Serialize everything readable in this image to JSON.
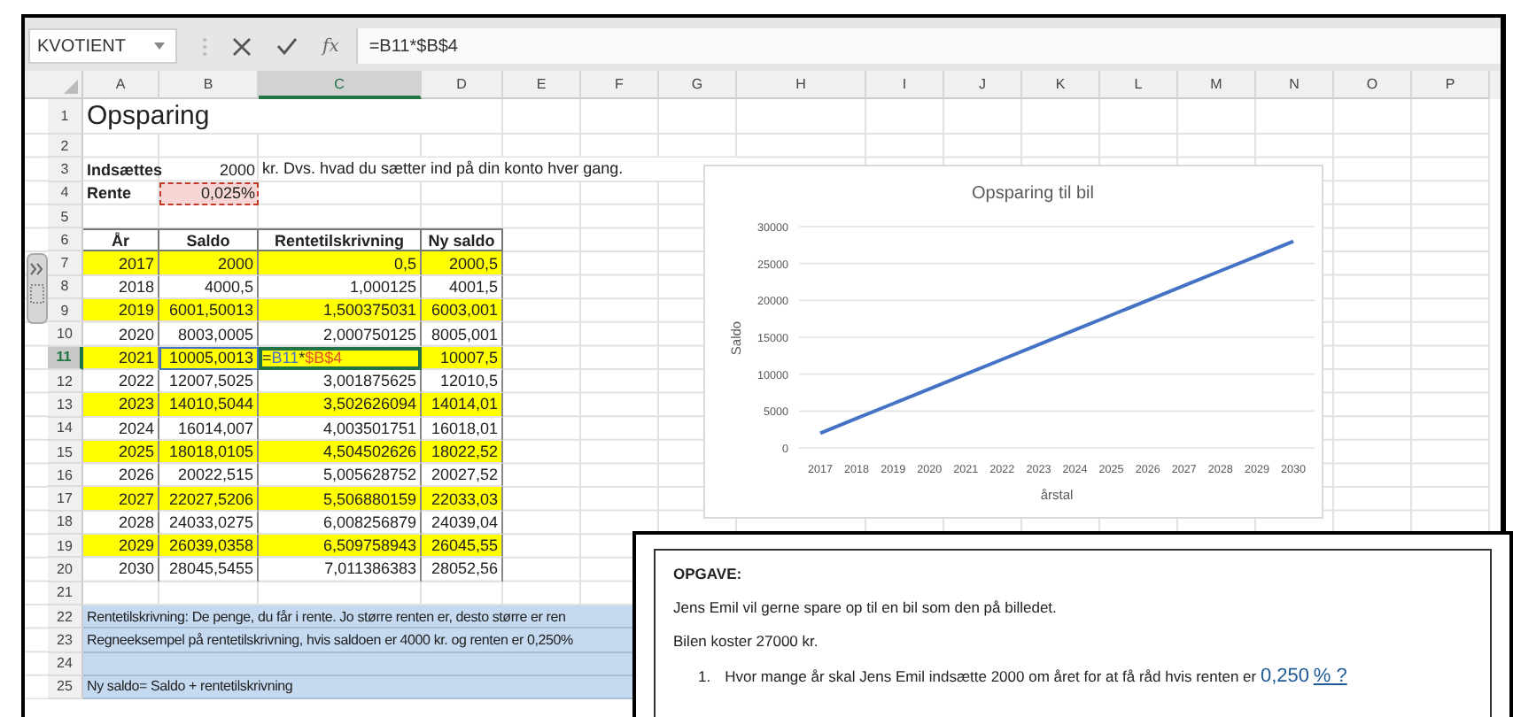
{
  "formula_bar": {
    "name_box": "KVOTIENT",
    "fx": "fx",
    "formula": "=B11*$B$4"
  },
  "columns": [
    {
      "label": "A",
      "selected": false
    },
    {
      "label": "B",
      "selected": false
    },
    {
      "label": "C",
      "selected": true
    },
    {
      "label": "D",
      "selected": false
    },
    {
      "label": "E",
      "selected": false
    },
    {
      "label": "F",
      "selected": false
    },
    {
      "label": "G",
      "selected": false
    },
    {
      "label": "H",
      "selected": false
    },
    {
      "label": "I",
      "selected": false
    },
    {
      "label": "J",
      "selected": false
    },
    {
      "label": "K",
      "selected": false
    },
    {
      "label": "L",
      "selected": false
    },
    {
      "label": "M",
      "selected": false
    },
    {
      "label": "N",
      "selected": false
    },
    {
      "label": "O",
      "selected": false
    },
    {
      "label": "P",
      "selected": false
    }
  ],
  "rows": [
    {
      "number": "1",
      "kind": "title",
      "text": "Opsparing"
    },
    {
      "number": "2",
      "kind": "blank"
    },
    {
      "number": "3",
      "kind": "input",
      "label": "Indsættes",
      "value": "2000",
      "note": "kr. Dvs. hvad du sætter ind på din konto hver gang.",
      "referenced": false
    },
    {
      "number": "4",
      "kind": "input",
      "label": "Rente",
      "value": "0,025%",
      "referenced": true
    },
    {
      "number": "5",
      "kind": "blank"
    },
    {
      "number": "6",
      "kind": "table_header",
      "cells": [
        "År",
        "Saldo",
        "Rentetilskrivning",
        "Ny saldo"
      ]
    },
    {
      "number": "7",
      "kind": "data",
      "highlighted": true,
      "selected": false,
      "year": "2017",
      "saldo": "2000",
      "rente": "0,5",
      "ny_saldo": "2000,5"
    },
    {
      "number": "8",
      "kind": "data",
      "highlighted": false,
      "selected": false,
      "year": "2018",
      "saldo": "4000,5",
      "rente": "1,000125",
      "ny_saldo": "4001,5"
    },
    {
      "number": "9",
      "kind": "data",
      "highlighted": true,
      "selected": false,
      "year": "2019",
      "saldo": "6001,50013",
      "rente": "1,500375031",
      "ny_saldo": "6003,001"
    },
    {
      "number": "10",
      "kind": "data",
      "highlighted": false,
      "selected": false,
      "year": "2020",
      "saldo": "8003,0005",
      "rente": "2,000750125",
      "ny_saldo": "8005,001"
    },
    {
      "number": "11",
      "kind": "data",
      "highlighted": true,
      "selected": true,
      "saldo_referenced": true,
      "year": "2021",
      "saldo": "10005,0013",
      "formula_parts": [
        {
          "text": "=",
          "kind": "plain"
        },
        {
          "text": "B11",
          "kind": "ref_1"
        },
        {
          "text": "*",
          "kind": "plain"
        },
        {
          "text": "$B$4",
          "kind": "ref_2"
        }
      ],
      "ny_saldo": "10007,5"
    },
    {
      "number": "12",
      "kind": "data",
      "highlighted": false,
      "selected": false,
      "year": "2022",
      "saldo": "12007,5025",
      "rente": "3,001875625",
      "ny_saldo": "12010,5"
    },
    {
      "number": "13",
      "kind": "data",
      "highlighted": true,
      "selected": false,
      "year": "2023",
      "saldo": "14010,5044",
      "rente": "3,502626094",
      "ny_saldo": "14014,01"
    },
    {
      "number": "14",
      "kind": "data",
      "highlighted": false,
      "selected": false,
      "year": "2024",
      "saldo": "16014,007",
      "rente": "4,003501751",
      "ny_saldo": "16018,01"
    },
    {
      "number": "15",
      "kind": "data",
      "highlighted": true,
      "selected": false,
      "year": "2025",
      "saldo": "18018,0105",
      "rente": "4,504502626",
      "ny_saldo": "18022,52"
    },
    {
      "number": "16",
      "kind": "data",
      "highlighted": false,
      "selected": false,
      "year": "2026",
      "saldo": "20022,515",
      "rente": "5,005628752",
      "ny_saldo": "20027,52"
    },
    {
      "number": "17",
      "kind": "data",
      "highlighted": true,
      "selected": false,
      "year": "2027",
      "saldo": "22027,5206",
      "rente": "5,506880159",
      "ny_saldo": "22033,03"
    },
    {
      "number": "18",
      "kind": "data",
      "highlighted": false,
      "selected": false,
      "year": "2028",
      "saldo": "24033,0275",
      "rente": "6,008256879",
      "ny_saldo": "24039,04"
    },
    {
      "number": "19",
      "kind": "data",
      "highlighted": true,
      "selected": false,
      "year": "2029",
      "saldo": "26039,0358",
      "rente": "6,509758943",
      "ny_saldo": "26045,55"
    },
    {
      "number": "20",
      "kind": "data",
      "highlighted": false,
      "selected": false,
      "year": "2030",
      "saldo": "28045,5455",
      "rente": "7,011386383",
      "ny_saldo": "28052,56"
    },
    {
      "number": "21",
      "kind": "blank"
    },
    {
      "number": "22",
      "kind": "note",
      "text": "Rentetilskrivning: De penge, du får i rente. Jo større renten er, desto større er ren"
    },
    {
      "number": "23",
      "kind": "note",
      "text": "Regneeksempel på rentetilskrivning, hvis saldoen er 4000 kr. og renten er 0,250%"
    },
    {
      "number": "24",
      "kind": "note"
    },
    {
      "number": "25",
      "kind": "note",
      "text": "Ny saldo= Saldo + rentetilskrivning"
    }
  ],
  "chart": {
    "chart_data": {
      "type": "line",
      "title": "Opsparing til bil",
      "xlabel": "årstal",
      "ylabel": "Saldo",
      "grid": true,
      "categories": [
        "2017",
        "2018",
        "2019",
        "2020",
        "2021",
        "2022",
        "2023",
        "2024",
        "2025",
        "2026",
        "2027",
        "2028",
        "2029",
        "2030"
      ],
      "series": [
        {
          "color": "#4472c4",
          "values": [
            2000,
            4000,
            6000,
            8000,
            10000,
            12000,
            14000,
            16000,
            18000,
            20000,
            22000,
            24000,
            26000,
            28000
          ]
        }
      ],
      "ylim": [
        0,
        30000
      ],
      "yticks": [
        0,
        5000,
        10000,
        15000,
        20000,
        25000,
        30000
      ]
    }
  },
  "task": {
    "heading": "OPGAVE:",
    "paragraphs": [
      "Jens Emil vil gerne spare op til en bil som den på billedet.",
      "Bilen koster 27000 kr."
    ],
    "questions": [
      {
        "number": "1.",
        "text": "Hvor mange år skal Jens Emil indsætte 2000 om året for at få råd hvis renten er",
        "value": "0,250",
        "unit": "% ?"
      }
    ]
  }
}
